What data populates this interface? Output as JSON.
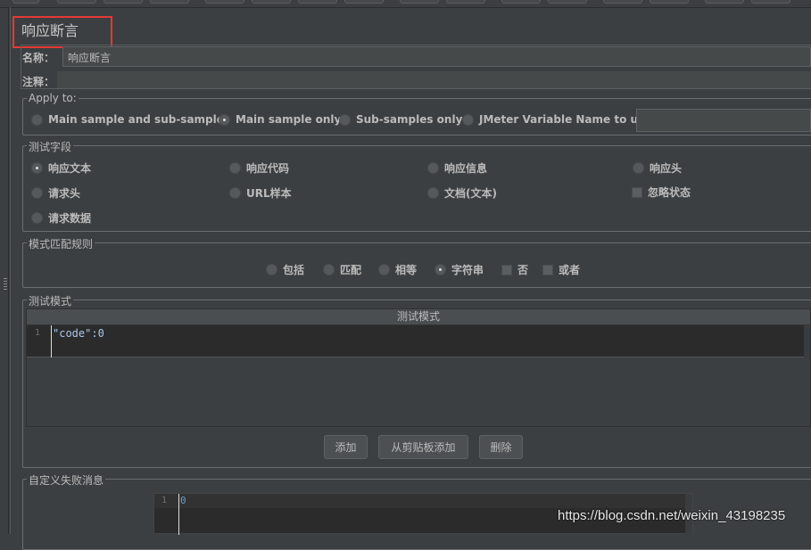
{
  "title": "响应断言",
  "name_label": "名称：",
  "name_value": "响应断言",
  "comment_label": "注释：",
  "comment_value": "",
  "apply_to": {
    "legend": "Apply to:",
    "options": [
      {
        "label": "Main sample and sub-samples",
        "checked": false
      },
      {
        "label": "Main sample only",
        "checked": true
      },
      {
        "label": "Sub-samples only",
        "checked": false
      },
      {
        "label": "JMeter Variable Name to use",
        "checked": false
      }
    ],
    "variable_value": ""
  },
  "test_field": {
    "legend": "测试字段",
    "options": [
      {
        "label": "响应文本",
        "checked": true
      },
      {
        "label": "响应代码",
        "checked": false
      },
      {
        "label": "响应信息",
        "checked": false
      },
      {
        "label": "响应头",
        "checked": false
      },
      {
        "label": "请求头",
        "checked": false
      },
      {
        "label": "URL样本",
        "checked": false
      },
      {
        "label": "文档(文本)",
        "checked": false
      },
      {
        "label": "忽略状态",
        "checked": false
      },
      {
        "label": "请求数据",
        "checked": false
      }
    ]
  },
  "match_rules": {
    "legend": "模式匹配规则",
    "options": [
      {
        "label": "包括",
        "checked": false
      },
      {
        "label": "匹配",
        "checked": false
      },
      {
        "label": "相等",
        "checked": false
      },
      {
        "label": "字符串",
        "checked": true
      }
    ],
    "checkboxes": [
      {
        "label": "否",
        "checked": false
      },
      {
        "label": "或者",
        "checked": false
      }
    ]
  },
  "patterns": {
    "legend": "测试模式",
    "column_header": "测试模式",
    "line_number": "1",
    "value": "\"code\":0",
    "buttons": {
      "add": "添加",
      "add_clipboard": "从剪贴板添加",
      "delete": "删除"
    }
  },
  "failure_message": {
    "legend": "自定义失败消息",
    "line_number": "1",
    "value": "0"
  },
  "watermark": "https://blog.csdn.net/weixin_43198235",
  "colors": {
    "background": "#3c3f41",
    "highlight_box": "#e53935"
  }
}
